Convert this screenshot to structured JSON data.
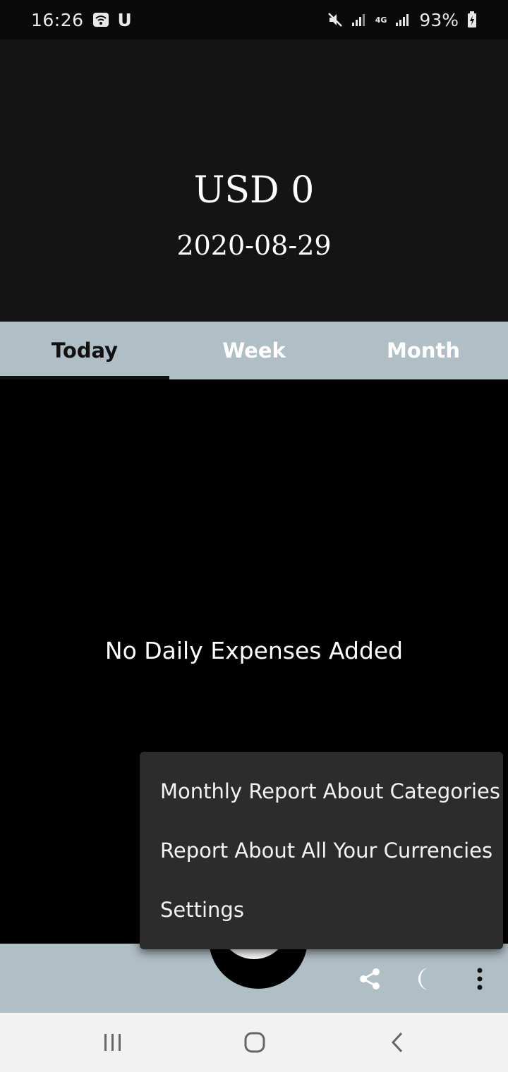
{
  "status_bar": {
    "time": "16:26",
    "carrier_glyph": "U",
    "battery": "93%",
    "network": "4G",
    "icons": [
      "wifi-icon",
      "mute-icon",
      "signal-icon",
      "battery-icon"
    ]
  },
  "header": {
    "balance": "USD 0",
    "date": "2020-08-29"
  },
  "tabs": [
    {
      "label": "Today",
      "active": true
    },
    {
      "label": "Week",
      "active": false
    },
    {
      "label": "Month",
      "active": false
    }
  ],
  "main": {
    "empty_message": "No Daily Expenses Added"
  },
  "menu": {
    "items": [
      {
        "label": "Monthly Report About Categories"
      },
      {
        "label": "Report About All Your Currencies"
      },
      {
        "label": "Settings"
      }
    ]
  },
  "bottom_bar": {
    "icons": [
      "edit-icon",
      "share-icon",
      "moon-icon",
      "more-vert-icon"
    ]
  },
  "colors": {
    "header_bg": "#141414",
    "tab_bar": "#b0bec5",
    "menu_bg": "#2c2c2c",
    "background": "#000000"
  }
}
